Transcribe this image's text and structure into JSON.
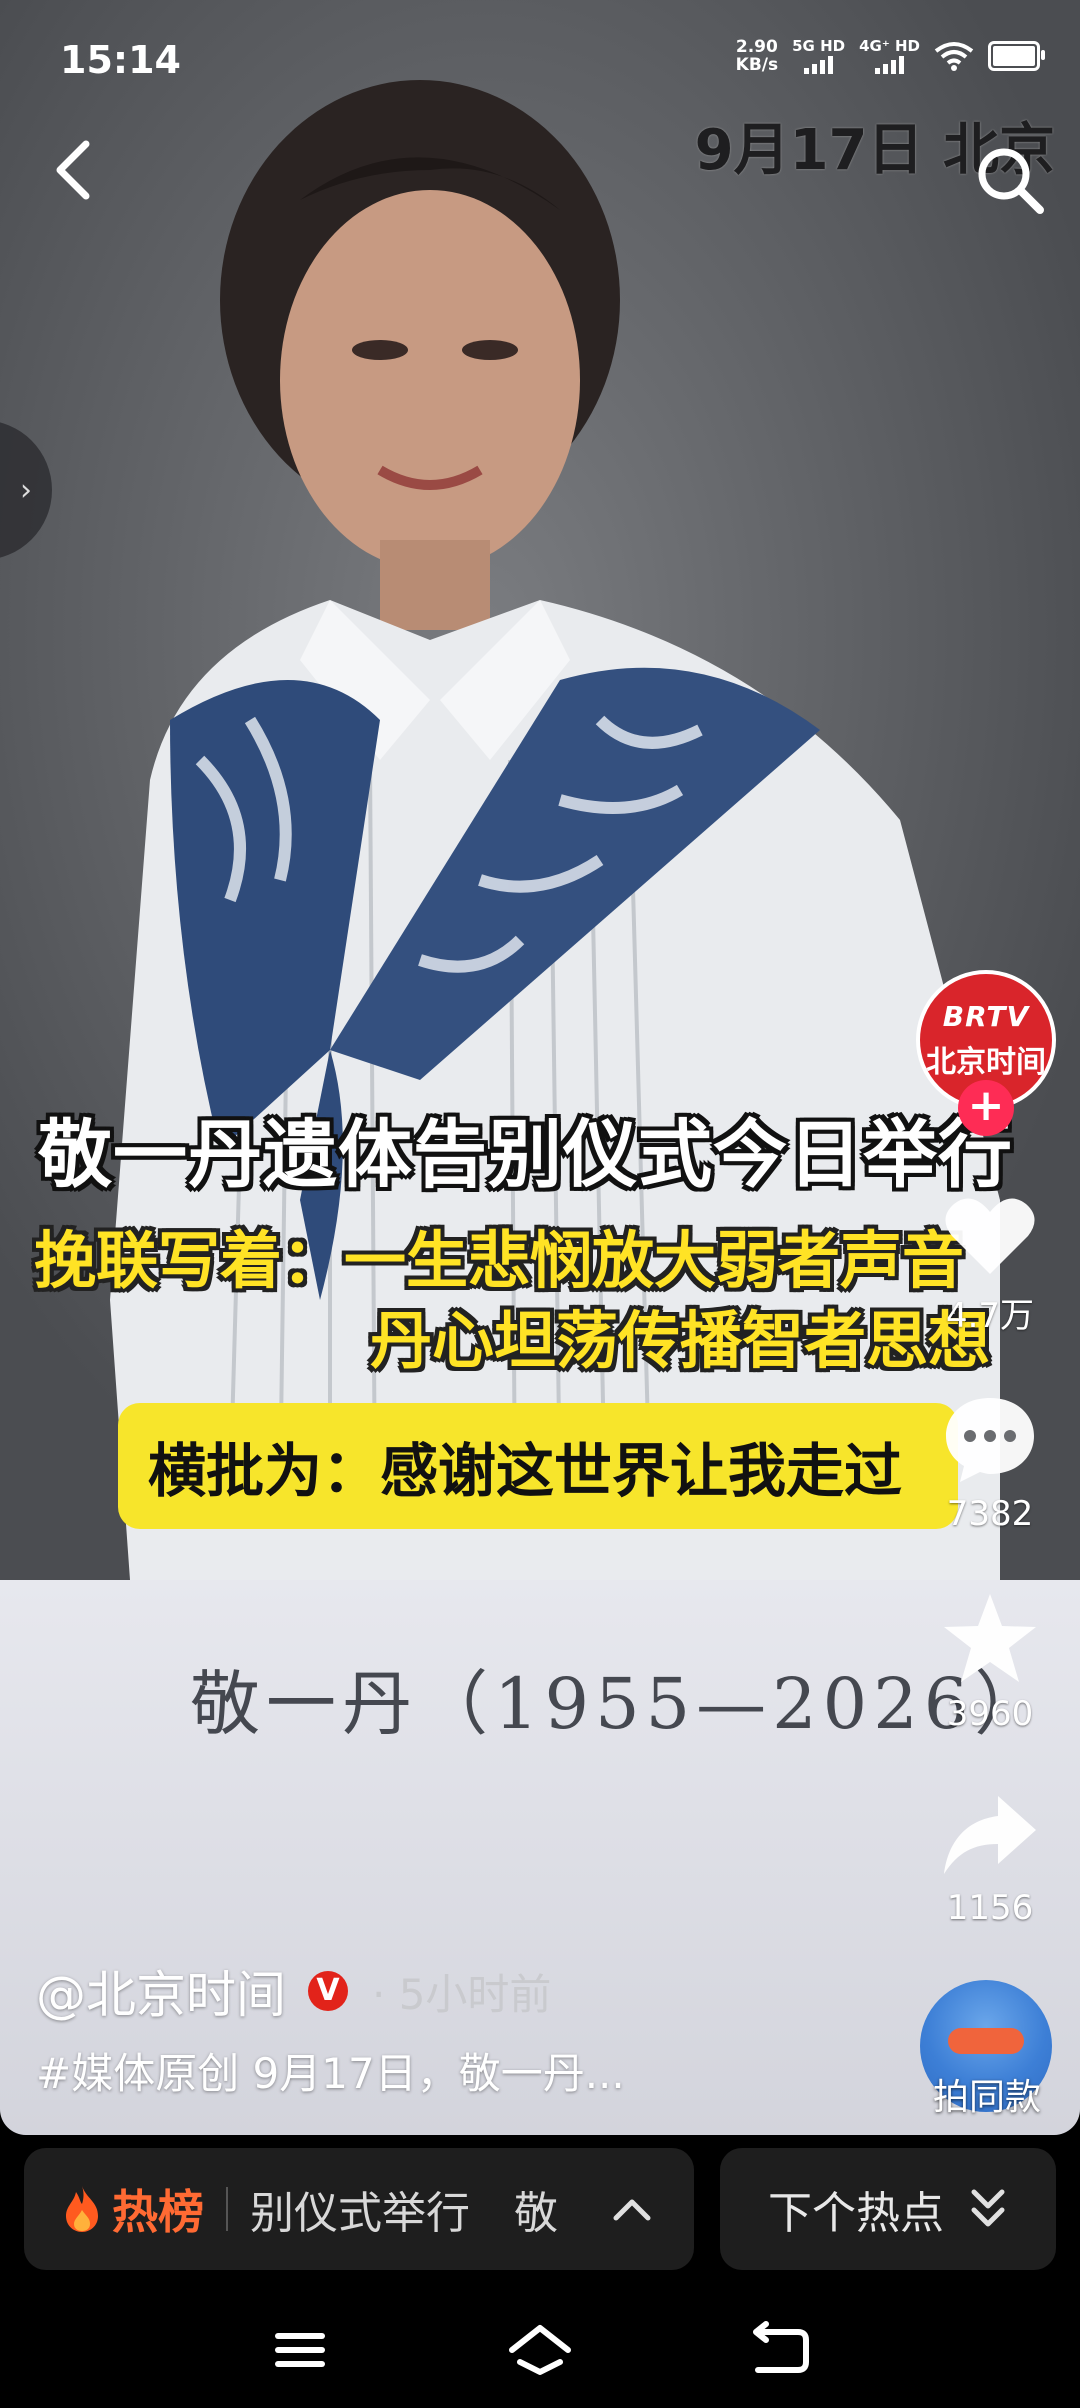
{
  "status_bar": {
    "time": "15:14",
    "net_speed_value": "2.90",
    "net_speed_unit": "KB/s",
    "sim1": "5G HD",
    "sim2": "4G⁺ HD"
  },
  "video": {
    "date_stamp": "9月17日 北京",
    "caption_title": "敬一丹遗体告别仪式今日举行",
    "caption_line1": "挽联写着：一生悲悯放大弱者声音",
    "caption_line2": "丹心坦荡传播智者思想",
    "caption_box": "横批为：感谢这世界让我走过",
    "name_board": "敬一丹（1955—2026）"
  },
  "rail": {
    "avatar_brand": "BRTV",
    "avatar_channel": "北京时间",
    "like_count": "4.7万",
    "comment_count": "7382",
    "favorite_count": "3960",
    "share_count": "1156",
    "make_same_label": "拍同款"
  },
  "author": {
    "name": "@北京时间",
    "verified_mark": "V",
    "time_ago": "· 5小时前",
    "description": "#媒体原创 9月17日，敬一丹..."
  },
  "bottom": {
    "hot_label": "热榜",
    "hot_text": "别仪式举行　敬",
    "next_label": "下个热点"
  },
  "colors": {
    "follow_red": "#fe2c55",
    "caption_yellow": "#ffe325",
    "hot_orange": "#ff6a33",
    "channel_red": "#d9252b"
  },
  "icons": [
    "back-arrow-icon",
    "search-icon",
    "chevron-right-icon",
    "heart-icon",
    "comment-icon",
    "star-icon",
    "share-icon",
    "flame-icon",
    "chevron-up-icon",
    "double-chevron-down-icon",
    "menu-icon",
    "home-icon",
    "back-icon"
  ]
}
